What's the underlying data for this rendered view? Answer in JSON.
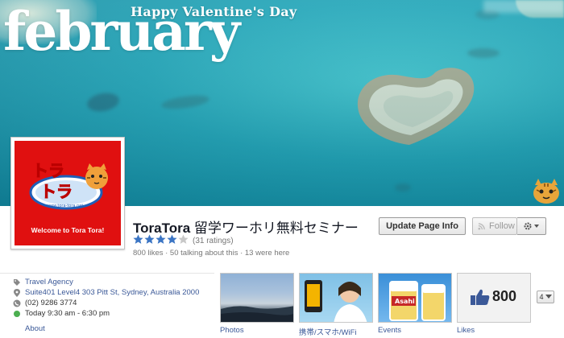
{
  "cover": {
    "headline": "february",
    "tagline": "Happy Valentine's Day"
  },
  "profile": {
    "logo_text_top": "トラ",
    "logo_text_bottom": "トラ",
    "logo_url": "www.tora-tora.net",
    "welcome": "Welcome to Tora Tora!"
  },
  "page": {
    "name": "ToraTora",
    "subtitle": "留学ワーホリ無料セミナー",
    "rating": 4,
    "rating_max": 5,
    "ratings_count": "(31 ratings)",
    "stats": "800 likes · 50 talking about this · 13 were here"
  },
  "actions": {
    "update_info": "Update Page Info",
    "follow": "Follow"
  },
  "about": {
    "category": "Travel Agency",
    "address": "Suite401 Level4 303 Pitt St, Sydney, Australia 2000",
    "phone": "(02) 9286 3774",
    "hours": "Today 9:30 am - 6:30 pm",
    "label": "About"
  },
  "apps": [
    {
      "label": "Photos"
    },
    {
      "label": "携帯/スマホ/WiFi"
    },
    {
      "label": "Events"
    },
    {
      "label": "Likes",
      "count": "800"
    }
  ],
  "more_count": "4",
  "colors": {
    "link": "#3b5998",
    "logo_red": "#e01010",
    "star": "#3b75c4",
    "open_dot": "#4caf50"
  }
}
